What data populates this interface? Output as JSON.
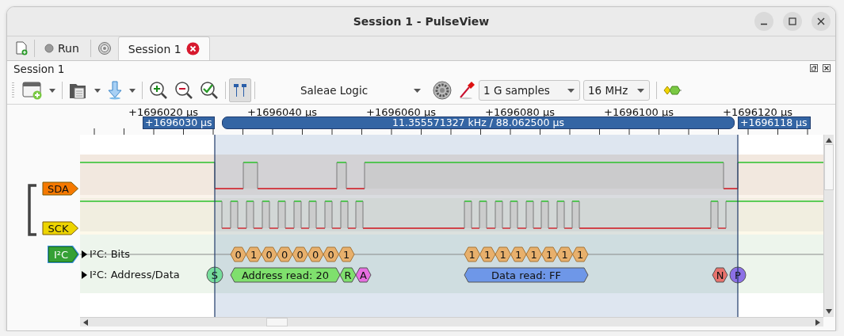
{
  "window": {
    "title": "Session 1 - PulseView"
  },
  "tab_bar": {
    "run_label": "Run",
    "tabs": [
      {
        "label": "Session 1",
        "selected": true
      }
    ]
  },
  "session": {
    "title": "Session 1"
  },
  "toolbar": {
    "cursors_on": true,
    "device": "Saleae Logic",
    "sample_count": "1 G samples",
    "sample_rate": "16 MHz"
  },
  "ruler": {
    "labels": [
      "+1696020 µs",
      "+1696040 µs",
      "+1696060 µs",
      "+1696080 µs",
      "+1696100 µs",
      "+1696120 µs"
    ]
  },
  "cursors": {
    "left": "+1696030 µs",
    "measurement": "11.355571327 kHz / 88.062500 µs",
    "right": "+1696118 µs"
  },
  "channels": [
    {
      "name": "SDA",
      "color": "#f57900"
    },
    {
      "name": "SCK",
      "color": "#edd400"
    }
  ],
  "decoder": {
    "name": "I²C",
    "rows": [
      {
        "name": "I²C: Bits",
        "expanded": false,
        "annotations": [
          {
            "text": "0",
            "kind": "bit"
          },
          {
            "text": "1",
            "kind": "bit"
          },
          {
            "text": "0",
            "kind": "bit"
          },
          {
            "text": "0",
            "kind": "bit"
          },
          {
            "text": "0",
            "kind": "bit"
          },
          {
            "text": "0",
            "kind": "bit"
          },
          {
            "text": "0",
            "kind": "bit"
          },
          {
            "text": "1",
            "kind": "bit"
          },
          {
            "text": "1",
            "kind": "bit"
          },
          {
            "text": "1",
            "kind": "bit"
          },
          {
            "text": "1",
            "kind": "bit"
          },
          {
            "text": "1",
            "kind": "bit"
          },
          {
            "text": "1",
            "kind": "bit"
          },
          {
            "text": "1",
            "kind": "bit"
          },
          {
            "text": "1",
            "kind": "bit"
          },
          {
            "text": "1",
            "kind": "bit"
          }
        ]
      },
      {
        "name": "I²C: Address/Data",
        "expanded": false,
        "annotations": [
          {
            "text": "S",
            "kind": "start",
            "color": "#76dd9b"
          },
          {
            "text": "Address read: 20",
            "kind": "address",
            "color": "#7fe06d"
          },
          {
            "text": "R",
            "kind": "rw",
            "color": "#7fe06d"
          },
          {
            "text": "A",
            "kind": "ack",
            "color": "#e66ee0"
          },
          {
            "text": "Data read: FF",
            "kind": "data",
            "color": "#6e97e8"
          },
          {
            "text": "N",
            "kind": "nack",
            "color": "#e8736d"
          },
          {
            "text": "P",
            "kind": "stop",
            "color": "#8c70e6"
          }
        ]
      }
    ]
  }
}
